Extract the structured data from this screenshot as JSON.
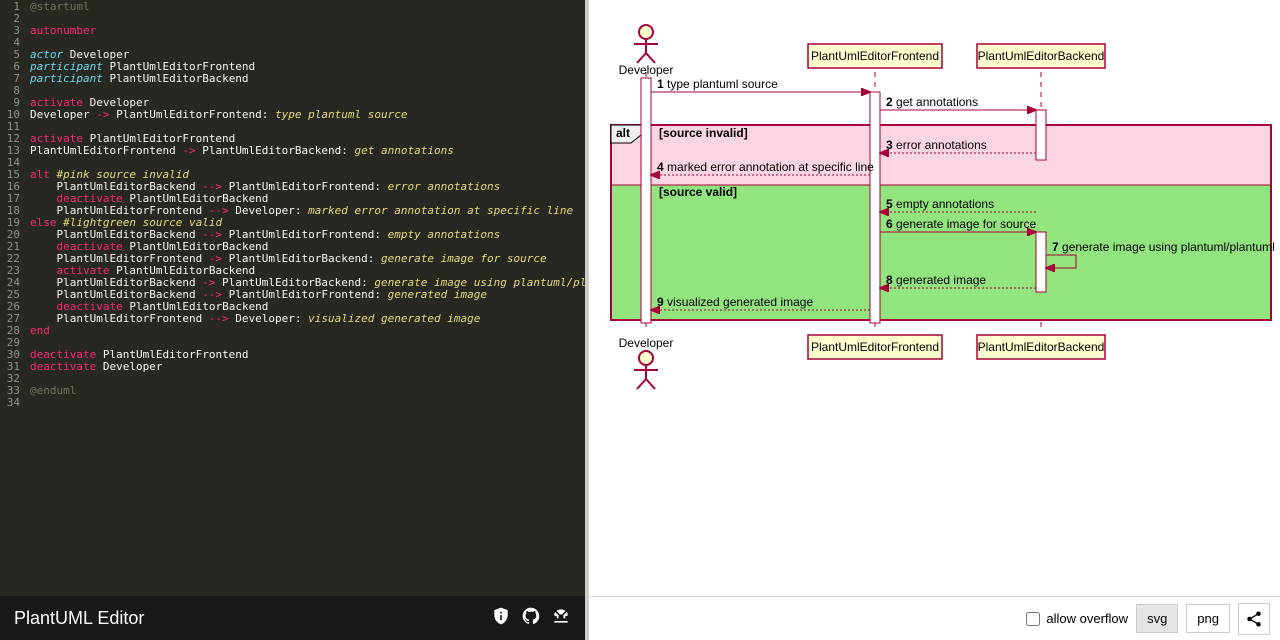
{
  "footer": {
    "title": "PlantUML Editor",
    "overflow_label": "allow overflow",
    "btn_svg": "svg",
    "btn_png": "png"
  },
  "code": [
    [
      [
        "c-gray",
        "@startuml"
      ]
    ],
    [],
    [
      [
        "c-pink",
        "autonumber"
      ]
    ],
    [],
    [
      [
        "c-blue",
        "actor"
      ],
      [
        "c-white",
        " Developer"
      ]
    ],
    [
      [
        "c-blue",
        "participant"
      ],
      [
        "c-white",
        " PlantUmlEditorFrontend"
      ]
    ],
    [
      [
        "c-blue",
        "participant"
      ],
      [
        "c-white",
        " PlantUmlEditorBackend"
      ]
    ],
    [],
    [
      [
        "c-pink",
        "activate"
      ],
      [
        "c-white",
        " Developer"
      ]
    ],
    [
      [
        "c-white",
        "Developer "
      ],
      [
        "c-pink",
        "->"
      ],
      [
        "c-white",
        " PlantUmlEditorFrontend: "
      ],
      [
        "c-yellow c-it",
        "type plantuml source"
      ]
    ],
    [],
    [
      [
        "c-pink",
        "activate"
      ],
      [
        "c-white",
        " PlantUmlEditorFrontend"
      ]
    ],
    [
      [
        "c-white",
        "PlantUmlEditorFrontend "
      ],
      [
        "c-pink",
        "->"
      ],
      [
        "c-white",
        " PlantUmlEditorBackend: "
      ],
      [
        "c-yellow c-it",
        "get annotations"
      ]
    ],
    [],
    [
      [
        "c-pink",
        "alt"
      ],
      [
        "c-yellow c-it",
        " #pink source invalid"
      ]
    ],
    [
      [
        "c-white",
        "    PlantUmlEditorBackend "
      ],
      [
        "c-pink",
        "-->"
      ],
      [
        "c-white",
        " PlantUmlEditorFrontend: "
      ],
      [
        "c-yellow c-it",
        "error annotations"
      ]
    ],
    [
      [
        "c-white",
        "    "
      ],
      [
        "c-pink",
        "deactivate"
      ],
      [
        "c-white",
        " PlantUmlEditorBackend"
      ]
    ],
    [
      [
        "c-white",
        "    PlantUmlEditorFrontend "
      ],
      [
        "c-pink",
        "-->"
      ],
      [
        "c-white",
        " Developer: "
      ],
      [
        "c-yellow c-it",
        "marked error annotation at specific line"
      ]
    ],
    [
      [
        "c-pink",
        "else"
      ],
      [
        "c-yellow c-it",
        " #lightgreen source valid"
      ]
    ],
    [
      [
        "c-white",
        "    PlantUmlEditorBackend "
      ],
      [
        "c-pink",
        "-->"
      ],
      [
        "c-white",
        " PlantUmlEditorFrontend: "
      ],
      [
        "c-yellow c-it",
        "empty annotations"
      ]
    ],
    [
      [
        "c-white",
        "    "
      ],
      [
        "c-pink",
        "deactivate"
      ],
      [
        "c-white",
        " PlantUmlEditorBackend"
      ]
    ],
    [
      [
        "c-white",
        "    PlantUmlEditorFrontend "
      ],
      [
        "c-pink",
        "->"
      ],
      [
        "c-white",
        " PlantUmlEditorBackend: "
      ],
      [
        "c-yellow c-it",
        "generate image for source"
      ]
    ],
    [
      [
        "c-white",
        "    "
      ],
      [
        "c-pink",
        "activate"
      ],
      [
        "c-white",
        " PlantUmlEditorBackend"
      ]
    ],
    [
      [
        "c-white",
        "    PlantUmlEditorBackend "
      ],
      [
        "c-pink",
        "->"
      ],
      [
        "c-white",
        " PlantUmlEditorBackend: "
      ],
      [
        "c-yellow c-it",
        "generate image using plantuml/plantuml"
      ]
    ],
    [
      [
        "c-white",
        "    PlantUmlEditorBackend "
      ],
      [
        "c-pink",
        "-->"
      ],
      [
        "c-white",
        " PlantUmlEditorFrontend: "
      ],
      [
        "c-yellow c-it",
        "generated image"
      ]
    ],
    [
      [
        "c-white",
        "    "
      ],
      [
        "c-pink",
        "deactivate"
      ],
      [
        "c-white",
        " PlantUmlEditorBackend"
      ]
    ],
    [
      [
        "c-white",
        "    PlantUmlEditorFrontend "
      ],
      [
        "c-pink",
        "-->"
      ],
      [
        "c-white",
        " Developer: "
      ],
      [
        "c-yellow c-it",
        "visualized generated image"
      ]
    ],
    [
      [
        "c-pink",
        "end"
      ]
    ],
    [],
    [
      [
        "c-pink",
        "deactivate"
      ],
      [
        "c-white",
        " PlantUmlEditorFrontend"
      ]
    ],
    [
      [
        "c-pink",
        "deactivate"
      ],
      [
        "c-white",
        " Developer"
      ]
    ],
    [],
    [
      [
        "c-gray",
        "@enduml"
      ]
    ],
    []
  ],
  "diagram": {
    "participants": {
      "dev": "Developer",
      "fe": "PlantUmlEditorFrontend",
      "be": "PlantUmlEditorBackend"
    },
    "alt_label": "alt",
    "cond_invalid": "[source invalid]",
    "cond_valid": "[source valid]",
    "msgs": {
      "m1": {
        "n": "1",
        "t": "type plantuml source"
      },
      "m2": {
        "n": "2",
        "t": "get annotations"
      },
      "m3": {
        "n": "3",
        "t": "error annotations"
      },
      "m4": {
        "n": "4",
        "t": "marked error annotation at specific line"
      },
      "m5": {
        "n": "5",
        "t": "empty annotations"
      },
      "m6": {
        "n": "6",
        "t": "generate image for source"
      },
      "m7": {
        "n": "7",
        "t": "generate image using plantuml/plantuml"
      },
      "m8": {
        "n": "8",
        "t": "generated image"
      },
      "m9": {
        "n": "9",
        "t": "visualized generated image"
      }
    }
  }
}
